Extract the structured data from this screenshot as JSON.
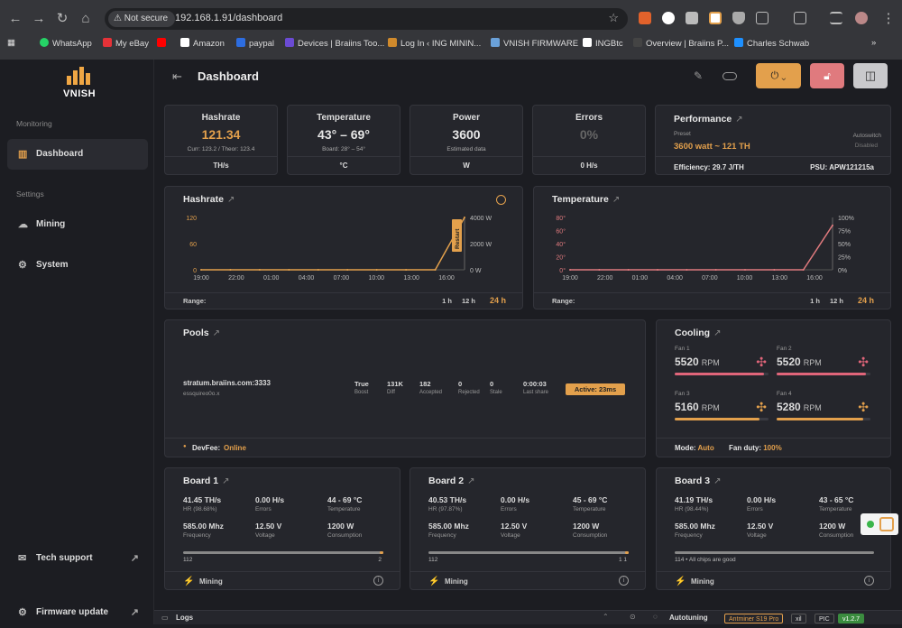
{
  "browser": {
    "security": "Not secure",
    "url": "192.168.1.91/dashboard"
  },
  "bookmarks": [
    {
      "label": "WhatsApp",
      "color": "#25d366"
    },
    {
      "label": "My eBay",
      "color": "#e53238"
    },
    {
      "label": "",
      "color": "#ff0000"
    },
    {
      "label": "Amazon",
      "color": "#ffffff"
    },
    {
      "label": "paypal",
      "color": "#2d6de0"
    },
    {
      "label": "Devices | Braiins Too...",
      "color": "#6b4bd4"
    },
    {
      "label": "Log In ‹ ING MININ...",
      "color": "#d08a2c"
    },
    {
      "label": "VNISH FIRMWARE",
      "color": "#6aa1d9"
    },
    {
      "label": "INGBtc",
      "color": "#ffffff"
    },
    {
      "label": "Overview | Braiins P...",
      "color": "#1b1b1b"
    },
    {
      "label": "Charles Schwab",
      "color": "#1e90ff"
    }
  ],
  "sidebar": {
    "brand": "VNISH",
    "monitoring_label": "Monitoring",
    "settings_label": "Settings",
    "items": {
      "dashboard": "Dashboard",
      "mining": "Mining",
      "system": "System",
      "support": "Tech support",
      "firmware": "Firmware update"
    }
  },
  "header": {
    "title": "Dashboard"
  },
  "kpis": {
    "hashrate": {
      "title": "Hashrate",
      "value": "121.34",
      "sub": "Curr: 123.2 / Theor: 123.4",
      "unit": "TH/s"
    },
    "temperature": {
      "title": "Temperature",
      "value": "43° – 69°",
      "sub": "Board: 28° – 54°",
      "unit": "°C"
    },
    "power": {
      "title": "Power",
      "value": "3600",
      "sub": "Estimated data",
      "unit": "W"
    },
    "errors": {
      "title": "Errors",
      "value": "0%",
      "unit": "0 H/s"
    }
  },
  "performance": {
    "title": "Performance",
    "preset_label": "Preset",
    "preset": "3600 watt ~ 121 TH",
    "autoswitch_label": "Autoswitch",
    "autoswitch": "Disabled",
    "efficiency_label": "Efficiency:",
    "efficiency": "29.7 J/TH",
    "psu_label": "PSU:",
    "psu": "APW121215a"
  },
  "chart_data": [
    {
      "type": "line",
      "title": "Hashrate",
      "x": [
        "19:00",
        "22:00",
        "01:00",
        "04:00",
        "07:00",
        "10:00",
        "13:00",
        "16:00"
      ],
      "y_ticks_left": [
        "120",
        "60",
        "0"
      ],
      "y_ticks_right": [
        "4000 W",
        "2000 W",
        "0 W"
      ],
      "ylim": [
        0,
        120
      ],
      "series": [
        {
          "values": [
            0,
            0,
            0,
            0,
            0,
            0,
            0,
            0,
            0,
            120
          ]
        }
      ],
      "annotation": "Restart",
      "range_label": "Range:",
      "ranges": [
        "1 h",
        "12 h",
        "24 h"
      ],
      "active_range": "24 h"
    },
    {
      "type": "line",
      "title": "Temperature",
      "x": [
        "19:00",
        "22:00",
        "01:00",
        "04:00",
        "07:00",
        "10:00",
        "13:00",
        "16:00"
      ],
      "y_ticks_left": [
        "80°",
        "60°",
        "40°",
        "20°",
        "0°"
      ],
      "y_ticks_right": [
        "100%",
        "75%",
        "50%",
        "25%",
        "0%"
      ],
      "ylim": [
        0,
        80
      ],
      "series": [
        {
          "values": [
            0,
            0,
            0,
            0,
            0,
            0,
            0,
            0,
            0,
            68
          ]
        }
      ],
      "range_label": "Range:",
      "ranges": [
        "1 h",
        "12 h",
        "24 h"
      ],
      "active_range": "24 h"
    }
  ],
  "pools": {
    "title": "Pools",
    "url": "stratum.braiins.com:3333",
    "user": "essquireo0o.x",
    "cols": [
      {
        "v": "True",
        "l": "Boost"
      },
      {
        "v": "131K",
        "l": "Diff"
      },
      {
        "v": "182",
        "l": "Accepted"
      },
      {
        "v": "0",
        "l": "Rejected"
      },
      {
        "v": "0",
        "l": "Stale"
      },
      {
        "v": "0:00:03",
        "l": "Last share"
      }
    ],
    "status": "Active: 23ms",
    "devfee_label": "DevFee:",
    "devfee": "Online"
  },
  "cooling": {
    "title": "Cooling",
    "fans": [
      {
        "name": "Fan 1",
        "rpm": "5520",
        "unit": "RPM",
        "level": 0.95,
        "color": "#e0657a"
      },
      {
        "name": "Fan 2",
        "rpm": "5520",
        "unit": "RPM",
        "level": 0.95,
        "color": "#e0657a"
      },
      {
        "name": "Fan 3",
        "rpm": "5160",
        "unit": "RPM",
        "level": 0.9,
        "color": "#e3a04c"
      },
      {
        "name": "Fan 4",
        "rpm": "5280",
        "unit": "RPM",
        "level": 0.92,
        "color": "#e3a04c"
      }
    ],
    "mode_label": "Mode:",
    "mode": "Auto",
    "duty_label": "Fan duty:",
    "duty": "100%"
  },
  "boards": [
    {
      "title": "Board 1",
      "hr": "41.45 TH/s",
      "hr_sub": "HR (98.68%)",
      "err": "0.00 H/s",
      "err_l": "Errors",
      "temp": "44 - 69 °C",
      "temp_l": "Temperature",
      "freq": "585.00 Mhz",
      "freq_l": "Frequency",
      "volt": "12.50 V",
      "volt_l": "Voltage",
      "cons": "1200 W",
      "cons_l": "Consumption",
      "chips_left": "112",
      "chips_right": "2",
      "status": "Mining"
    },
    {
      "title": "Board 2",
      "hr": "40.53 TH/s",
      "hr_sub": "HR (97.87%)",
      "err": "0.00 H/s",
      "err_l": "Errors",
      "temp": "45 - 69 °C",
      "temp_l": "Temperature",
      "freq": "585.00 Mhz",
      "freq_l": "Frequency",
      "volt": "12.50 V",
      "volt_l": "Voltage",
      "cons": "1200 W",
      "cons_l": "Consumption",
      "chips_left": "112",
      "chips_right": "1 1",
      "status": "Mining"
    },
    {
      "title": "Board 3",
      "hr": "41.19 TH/s",
      "hr_sub": "HR (98.44%)",
      "err": "0.00 H/s",
      "err_l": "Errors",
      "temp": "43 - 65 °C",
      "temp_l": "Temperature",
      "freq": "585.00 Mhz",
      "freq_l": "Frequency",
      "volt": "12.50 V",
      "volt_l": "Voltage",
      "cons": "1200 W",
      "cons_l": "Consumption",
      "chips_left": "114 • All chips are good",
      "chips_right": "",
      "status": "Mining"
    }
  ],
  "footer": {
    "logs": "Logs",
    "autotuning": "Autotuning",
    "model": "Antminer S19 Pro",
    "xil": "xil",
    "pic": "PIC",
    "version": "v1.2.7"
  }
}
